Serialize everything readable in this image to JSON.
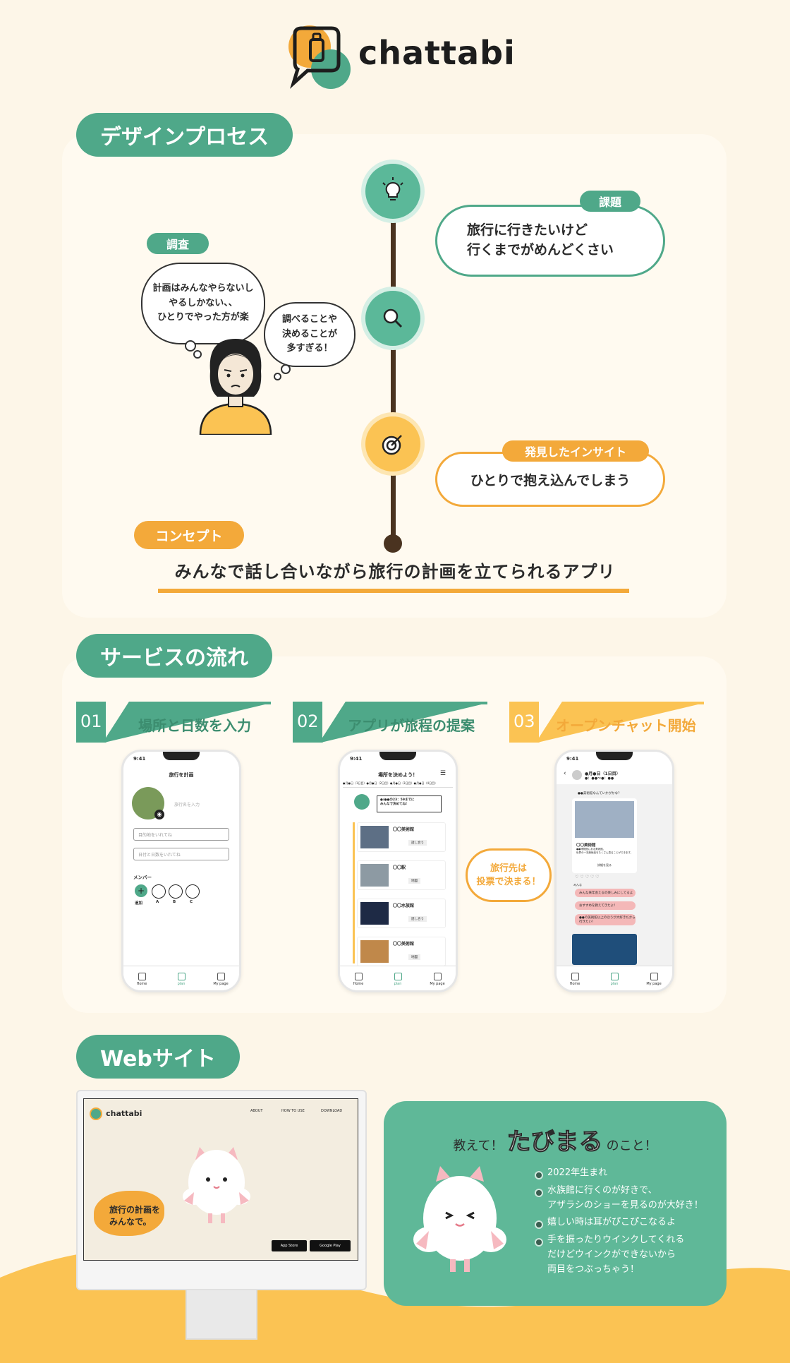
{
  "brand": {
    "name": "chattabi"
  },
  "design_process": {
    "section_title": "デザインプロセス",
    "research": {
      "label": "調査",
      "thought1": "計画はみんなやらないし\nやるしかない、、\nひとりでやった方が楽",
      "thought2": "調べることや\n決めることが\n多すぎる！"
    },
    "issue": {
      "label": "課題",
      "text": "旅行に行きたいけど\n行くまでがめんどくさい"
    },
    "insight": {
      "label": "発見したインサイト",
      "text": "ひとりで抱え込んでしまう"
    },
    "concept": {
      "label": "コンセプト",
      "text": "みんなで話し合いながら旅行の計画を立てられるアプリ"
    },
    "colors": {
      "green": "#4fa889",
      "orange": "#f3a93a",
      "brown": "#4a3320"
    }
  },
  "service_flow": {
    "section_title": "サービスの流れ",
    "steps": [
      {
        "num": "01",
        "label": "場所と日数を入力"
      },
      {
        "num": "02",
        "label": "アプリが旅程の提案"
      },
      {
        "num": "03",
        "label": "オープンチャット開始"
      }
    ],
    "vote_bubble": "旅行先は\n投票で決まる！",
    "phone1": {
      "time": "9:41",
      "title": "旅行を計画",
      "name_placeholder": "旅行名を入力",
      "dest_placeholder": "目的地をいれてね",
      "date_placeholder": "日付と日数をいれてね",
      "members_label": "メンバー",
      "member_labels": [
        "追加",
        "A",
        "B",
        "C"
      ],
      "nav": [
        "Home",
        "plan",
        "My page"
      ]
    },
    "phone2": {
      "time": "9:41",
      "title": "場所を決めよう！",
      "tabs": "●月●日（1日目）●月●日（2日目）●月●日（3日目）●月●日（4日目）",
      "deadline": "●/●●の23：59までに\nみんなで決めてね!",
      "items": [
        "〇〇美術館",
        "〇〇駅",
        "〇〇水族館",
        "〇〇美術館"
      ],
      "item_actions": [
        "話し合う",
        "地図",
        "話し合う",
        "地図"
      ],
      "nav": [
        "Home",
        "plan",
        "My page"
      ]
    },
    "phone3": {
      "time": "9:41",
      "title": "●月●日（1日目）",
      "subtitle": "●：●●〜●：●●",
      "intro": "●●美術館なんていかがかな？",
      "place": "〇〇美術館",
      "place_desc": "●●博物館にある美術館。\n世界の一流美術品をたくさん見ることができます。",
      "detail": "詳細を見る",
      "user_label": "みんな",
      "messages": [
        "みんな来年会えるの楽しみにしてるよ",
        "おすすめを教えてきたよ！",
        "●●の美術館以上のほうが大好きだから行きたい！"
      ],
      "nav": [
        "Home",
        "plan",
        "My page"
      ]
    }
  },
  "website": {
    "section_title": "Webサイト",
    "nav": [
      "ABOUT",
      "HOW TO USE",
      "DOWNLOAD"
    ],
    "hero_text": "旅行の計画を\nみんなで。",
    "store_buttons": [
      "App Store",
      "Google Play"
    ]
  },
  "character": {
    "heading_pre": "教えて！",
    "heading_name": "たびまる",
    "heading_post": "のこと！",
    "facts": [
      "2022年生まれ",
      "水族館に行くのが好きで、\nアザラシのショーを見るのが大好き！",
      "嬉しい時は耳がぴこぴこなるよ",
      "手を振ったりウインクしてくれる\nだけどウインクができないから\n両目をつぶっちゃう！"
    ]
  }
}
